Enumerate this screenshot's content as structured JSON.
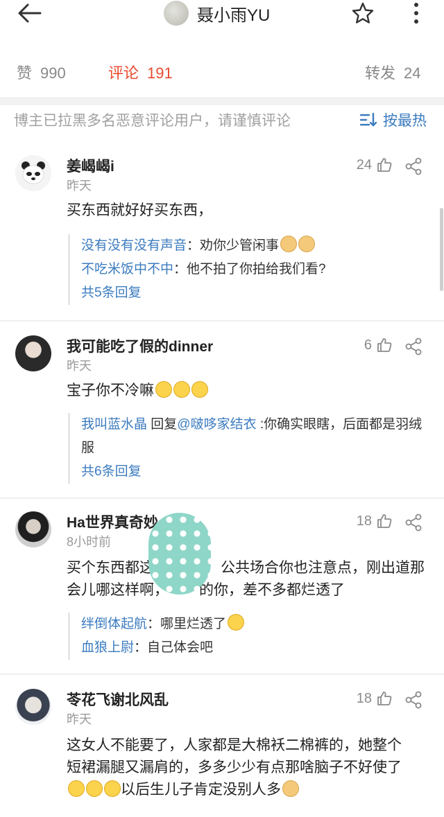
{
  "header": {
    "title": "聂小雨YU",
    "back_icon": "arrow-left-icon",
    "star_icon": "star-icon",
    "more_icon": "more-vertical-icon"
  },
  "stats": {
    "like_label": "赞",
    "like_count": "990",
    "comment_label": "评论",
    "comment_count": "191",
    "repost_label": "转发",
    "repost_count": "24",
    "accent": "#ea4a2f"
  },
  "notice": "博主已拉黑多名恶意评论用户，请谨慎评论",
  "sort_label": "按最热",
  "link_color": "#3b7bbf",
  "comments": [
    {
      "user": "姜嵑嵑i",
      "time": "昨天",
      "likes": "24",
      "text": "买东西就好好买东西，",
      "replies": [
        {
          "name": "没有没有没有声音",
          "sep": "：",
          "text": "劝你少管闲事"
        },
        {
          "name": "不吃米饭中不中",
          "sep": "：",
          "text": "他不拍了你拍给我们看?"
        }
      ],
      "reply_count": "共5条回复"
    },
    {
      "user": "我可能吃了假的dinner",
      "time": "昨天",
      "likes": "6",
      "text": "宝子你不冷嘛",
      "replies": [
        {
          "name": "我叫蓝水晶",
          "mid": " 回复",
          "name2": "@啵哆家结衣",
          "sep": " :",
          "text": "你确实眼瞎，后面都是羽绒服"
        }
      ],
      "reply_count": "共6条回复"
    },
    {
      "user": "Ha世界真奇妙",
      "time": "8小时前",
      "likes": "18",
      "text_line1": "买个东西都这",
      "text_line1b": "公共场合你也注意点，刚出道那",
      "text_line2": "会儿哪这样啊，",
      "text_line2b": "的你，差不多都烂透了",
      "replies": [
        {
          "name": "绊倒体起航",
          "sep": "：",
          "text": "哪里烂透了"
        },
        {
          "name": "血狼上尉",
          "sep": "：",
          "text": "自己体会吧"
        }
      ]
    },
    {
      "user": "苓花飞谢北风乱",
      "time": "昨天",
      "likes": "18",
      "text_line1": "这女人不能要了，人家都是大棉袄二棉裤的，她整个",
      "text_line2": "短裙漏腿又漏肩的，多多少少有点那啥脑子不好使了",
      "text_line3": "以后生儿子肯定没别人多"
    }
  ]
}
